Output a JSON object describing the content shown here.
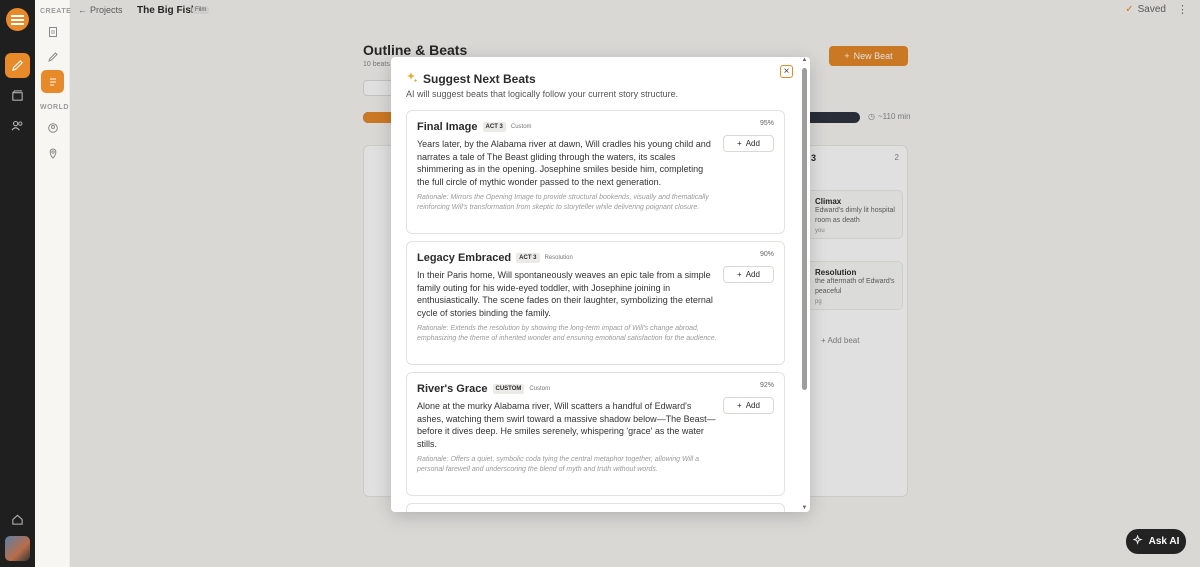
{
  "rail": {
    "items": [
      "logo-icon",
      "pen-icon",
      "film-icon",
      "users-icon",
      "home-icon"
    ]
  },
  "sidebar": {
    "create_label": "CREATE",
    "world_label": "WORLD"
  },
  "topbar": {
    "back_label": "Projects",
    "project_title": "The Big Fish",
    "project_type": "Film",
    "saved_label": "Saved"
  },
  "page": {
    "title": "Outline & Beats",
    "subtitle": "10 beats",
    "new_beat_label": "New Beat",
    "runtime": "~110 min",
    "progress_fraction": 0.08
  },
  "right_column": {
    "header": "3",
    "count": "2",
    "items": [
      {
        "title": "Climax",
        "text": "Edward's dimly lit hospital room as death",
        "page": "you"
      },
      {
        "title": "Resolution",
        "text": "the aftermath of Edward's peaceful",
        "page": "pg"
      }
    ],
    "add_beat_label": "Add beat"
  },
  "modal": {
    "title": "Suggest Next Beats",
    "subtitle": "AI will suggest beats that logically follow your current story structure.",
    "add_label": "Add",
    "suggestions": [
      {
        "name": "Final Image",
        "act": "ACT 3",
        "tag": "Custom",
        "score": "95%",
        "body": "Years later, by the Alabama river at dawn, Will cradles his young child and narrates a tale of The Beast gliding through the waters, its scales shimmering as in the opening. Josephine smiles beside him, completing the full circle of mythic wonder passed to the next generation.",
        "rationale": "Rationale: Mirrors the Opening Image to provide structural bookends, visually and thematically reinforcing Will's transformation from skeptic to storyteller while delivering poignant closure."
      },
      {
        "name": "Legacy Embraced",
        "act": "ACT 3",
        "tag": "Resolution",
        "score": "90%",
        "body": "In their Paris home, Will spontaneously weaves an epic tale from a simple family outing for his wide-eyed toddler, with Josephine joining in enthusiastically. The scene fades on their laughter, symbolizing the eternal cycle of stories binding the family.",
        "rationale": "Rationale: Extends the resolution by showing the long-term impact of Will's change abroad, emphasizing the theme of inherited wonder and ensuring emotional satisfaction for the audience."
      },
      {
        "name": "River's Grace",
        "act": "CUSTOM",
        "tag": "Custom",
        "score": "92%",
        "body": "Alone at the murky Alabama river, Will scatters a handful of Edward's ashes, watching them swirl toward a massive shadow below—The Beast—before it dives deep. He smiles serenely, whispering 'grace' as the water stills.",
        "rationale": "Rationale: Offers a quiet, symbolic coda tying the central metaphor together, allowing Will a personal farewell and underscoring the blend of myth and truth without words."
      }
    ]
  },
  "ask_ai_label": "Ask AI",
  "colors": {
    "accent": "#e8892a",
    "rail": "#1f1f1f"
  }
}
